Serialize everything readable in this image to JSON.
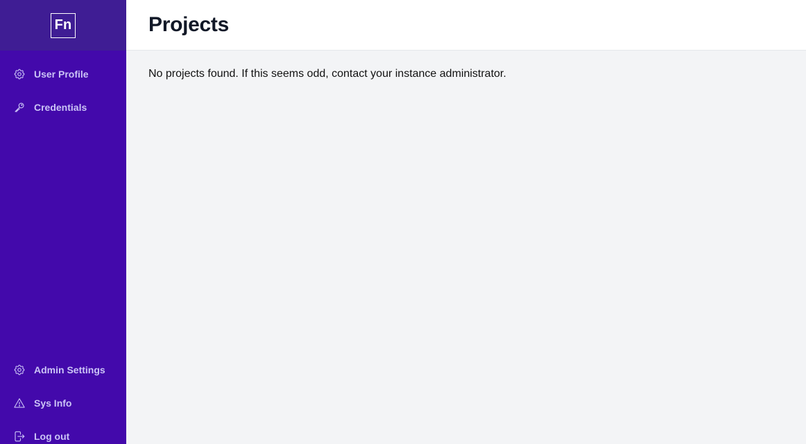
{
  "sidebar": {
    "logo": "Fn",
    "top_items": [
      {
        "label": "User Profile",
        "icon": "gear-icon"
      },
      {
        "label": "Credentials",
        "icon": "key-icon"
      }
    ],
    "bottom_items": [
      {
        "label": "Admin Settings",
        "icon": "gear-icon"
      },
      {
        "label": "Sys Info",
        "icon": "warning-triangle-icon"
      },
      {
        "label": "Log out",
        "icon": "logout-icon"
      }
    ]
  },
  "header": {
    "title": "Projects"
  },
  "main": {
    "empty_message": "No projects found. If this seems odd, contact your instance administrator."
  },
  "colors": {
    "sidebar_bg": "#4309ab",
    "sidebar_header_bg": "#3f1d94",
    "sidebar_text": "#cbc4f6",
    "main_bg": "#f3f4f6",
    "title_text": "#111827"
  }
}
